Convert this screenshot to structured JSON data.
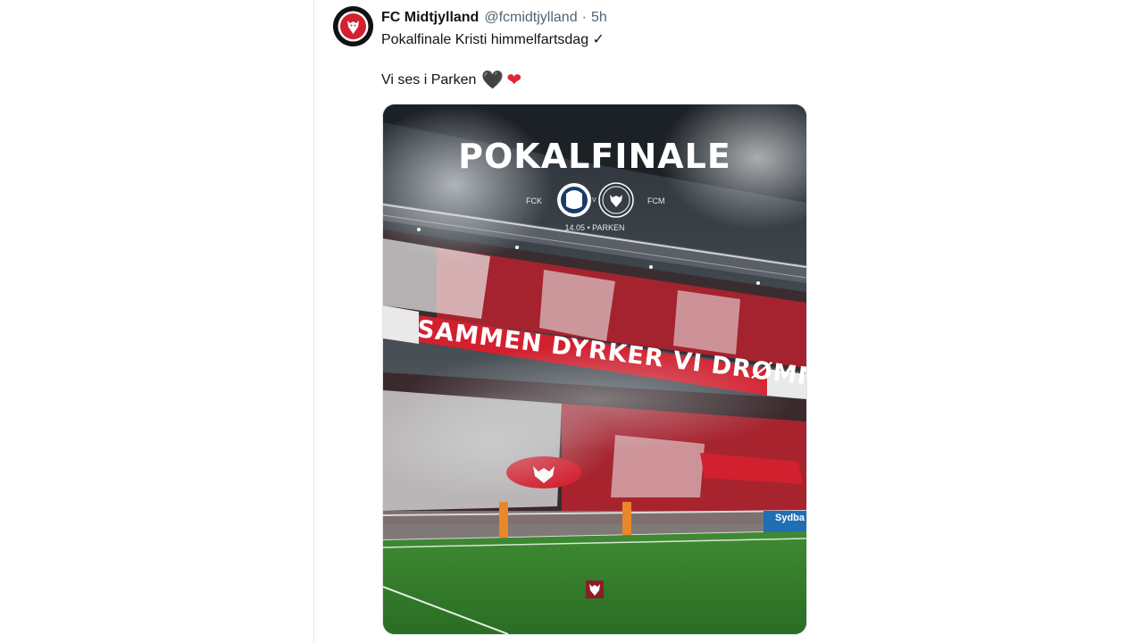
{
  "tweet": {
    "display_name": "FC Midtjylland",
    "handle": "@fcmidtjylland",
    "separator": "·",
    "time": "5h",
    "text_line1": "Pokalfinale Kristi himmelfartsdag ✓",
    "text_line2": "Vi ses i Parken",
    "emojis": [
      "🖤",
      "❤"
    ]
  },
  "avatar": {
    "icon": "fc-midtjylland-crest-icon"
  },
  "media": {
    "poster_title": "POKALFINALE",
    "team_left": "FCK",
    "versus": "V",
    "team_right": "FCM",
    "date_venue": "14.05 • PARKEN",
    "banner": "SAMMEN DYRKER VI DRØMMEN",
    "ad_board": "Sydba"
  },
  "colors": {
    "brand_red": "#d3202f",
    "text_primary": "#0f1419",
    "text_secondary": "#536471",
    "pitch_green": "#2f7d2a"
  }
}
